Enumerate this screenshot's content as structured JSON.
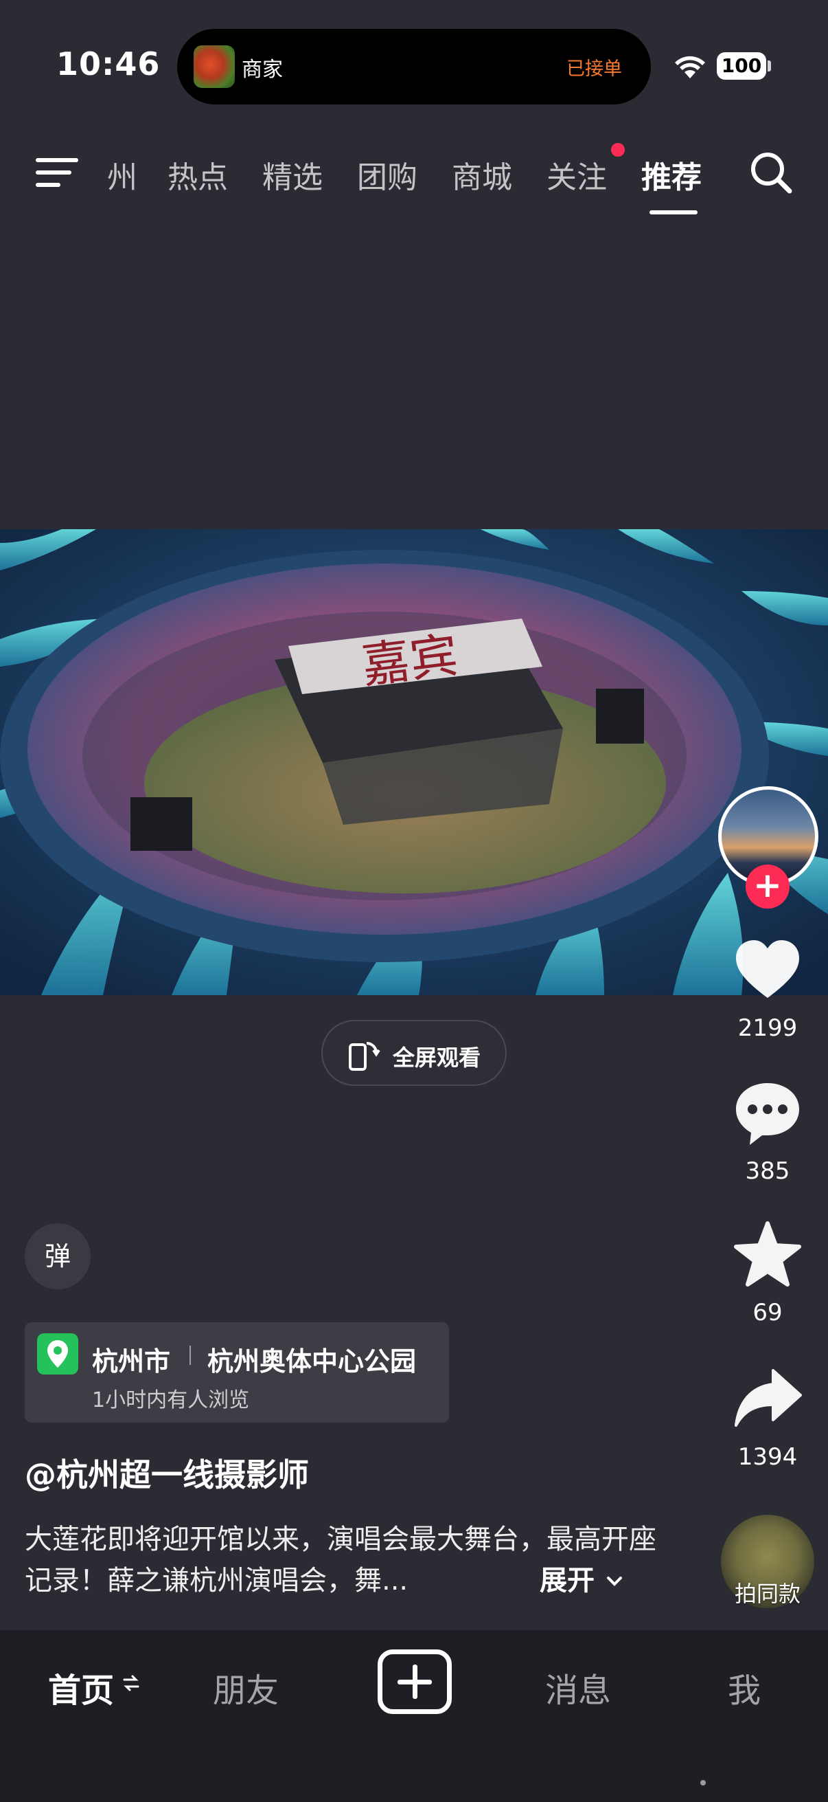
{
  "status_bar": {
    "time": "10:46",
    "island": {
      "label": "商家",
      "status": "已接单",
      "status_color": "#f57a2e"
    },
    "battery": "100"
  },
  "top_nav": {
    "tabs": [
      {
        "label": "州",
        "active": false
      },
      {
        "label": "热点",
        "active": false
      },
      {
        "label": "精选",
        "active": false
      },
      {
        "label": "团购",
        "active": false
      },
      {
        "label": "商城",
        "active": false
      },
      {
        "label": "关注",
        "active": false,
        "has_dot": true
      },
      {
        "label": "推荐",
        "active": true
      }
    ],
    "icons": [
      "menu-icon",
      "search-icon"
    ]
  },
  "video": {
    "fullscreen_label": "全屏观看"
  },
  "right_rail": {
    "likes": "2199",
    "comments": "385",
    "favorites": "69",
    "shares": "1394",
    "music_label": "拍同款",
    "follow_symbol": "+"
  },
  "info": {
    "danmu_label": "弹",
    "poi": {
      "city": "杭州市",
      "name": "杭州奥体中心公园",
      "subtitle": "1小时内有人浏览"
    },
    "author": "@杭州超一线摄影师",
    "caption": "大莲花即将迎开馆以来，演唱会最大舞台，最高开座记录！薛之谦杭州演唱会，舞...",
    "expand_label": "展开"
  },
  "bottom_tabs": [
    {
      "label": "首页",
      "active": true
    },
    {
      "label": "朋友",
      "active": false
    },
    {
      "label": "消息",
      "active": false
    },
    {
      "label": "我",
      "active": false
    }
  ],
  "colors": {
    "background": "#2b2c33",
    "accent_red": "#fe2c55",
    "poi_green": "#25c15a"
  }
}
